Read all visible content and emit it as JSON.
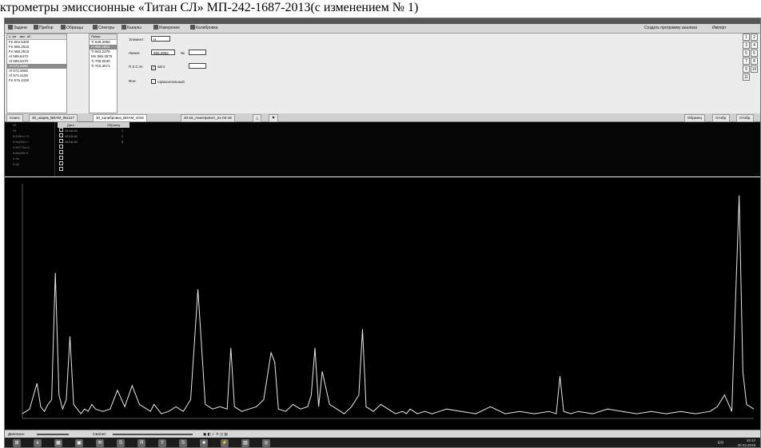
{
  "caption": "ктрометры эмиссионные «Титан СЛ»     МП-242-1687-2013(с изменением № 1)",
  "toolbar": {
    "items": [
      "Задачи",
      "Прибор",
      "Образцы",
      "Спектры",
      "Каналы",
      "Измерение",
      "Калибровка"
    ],
    "right_link": "Создать программу анализа",
    "right_menu": "Импорт"
  },
  "left_list": {
    "headers": [
      "λ, нм",
      "мкл",
      "α0"
    ],
    "items": [
      "Fe 504.5400",
      "Fe 566.2515",
      "Fe 568.2515",
      "Al 569.6470",
      "Al 569.6470",
      "Al 572.2650",
      "Al 572.2650",
      "Al 574.4150",
      "Fe 576.4150"
    ],
    "selected_index": 5
  },
  "line_list": {
    "header": "Линия",
    "items": [
      "Ti 649.2968",
      "H 656.2852",
      "Ti 662.2375",
      "Mn 686.3575",
      "Ti 708.2040",
      "Ti 715.3671"
    ],
    "selected_index": 1
  },
  "form": {
    "element_label": "Элемент:",
    "element_value": "H",
    "line_label": "Линия:",
    "line_value": "656.2852",
    "nr_label": "№",
    "ps_label": "П.З.С.%:",
    "ps_check": "авто",
    "phon_label": "Фон:",
    "phon_check": "горизонтальный"
  },
  "num_grid": [
    "1",
    "2",
    "3",
    "4",
    "5",
    "6",
    "7",
    "8",
    "9",
    "10",
    "11"
  ],
  "tabs": [
    "Сеанс",
    "30_шарик_ВИАМ_051117",
    "30_калибровка_ВИАМ_1018",
    "40-18_Анкетфлинт_21-02-18"
  ],
  "tabs_right": [
    "Образец",
    "Отобр.",
    "Отобр."
  ],
  "dark_left": [
    "Hf",
    "Hf",
    "6.8.8Fe=+2",
    "5.5d1Rb+=",
    "0.8d773н+2",
    "8.8d1Rb+1",
    "9.9d",
    "5.5d"
  ],
  "dark_table": {
    "headers": [
      "Дата",
      "Образец"
    ],
    "rows": [
      "15:16:16",
      "15:16:16",
      "15:16:16",
      "",
      "",
      "",
      "",
      ""
    ],
    "counts": [
      "1",
      "2",
      "3"
    ]
  },
  "statusbar": {
    "left": "Диапазон:",
    "mid": "Сжатие:"
  },
  "taskbar": {
    "icons": [
      "windows-icon",
      "edge-icon",
      "explorer-icon",
      "store-icon",
      "mail-icon",
      "skype-icon",
      "yandex-icon",
      "yandex-browser-icon",
      "skype2-icon",
      "terminal-icon",
      "spectrum-icon",
      "paint-icon",
      "other-icon"
    ],
    "lang": "EN",
    "time": "15:14",
    "date": "20.03.2019"
  },
  "chart_data": {
    "type": "line",
    "title": "",
    "xlabel": "",
    "ylabel": "",
    "x_range": [
      0,
      1
    ],
    "ylim": [
      0,
      1
    ],
    "grid": false,
    "series": [
      {
        "x": [
          0.0,
          0.01,
          0.02,
          0.025,
          0.03,
          0.035,
          0.04,
          0.045,
          0.05,
          0.055,
          0.06,
          0.065,
          0.07,
          0.08,
          0.085,
          0.09,
          0.095,
          0.1,
          0.11,
          0.12,
          0.13,
          0.14,
          0.15,
          0.16,
          0.17,
          0.175,
          0.18,
          0.19,
          0.2,
          0.21,
          0.22,
          0.23,
          0.24,
          0.25,
          0.26,
          0.27,
          0.28,
          0.285,
          0.29,
          0.3,
          0.31,
          0.32,
          0.33,
          0.34,
          0.345,
          0.35,
          0.36,
          0.37,
          0.38,
          0.39,
          0.395,
          0.4,
          0.405,
          0.41,
          0.42,
          0.43,
          0.44,
          0.45,
          0.46,
          0.465,
          0.47,
          0.48,
          0.49,
          0.5,
          0.51,
          0.52,
          0.525,
          0.53,
          0.54,
          0.55,
          0.56,
          0.57,
          0.58,
          0.6,
          0.62,
          0.64,
          0.66,
          0.68,
          0.7,
          0.72,
          0.73,
          0.735,
          0.74,
          0.75,
          0.76,
          0.78,
          0.8,
          0.82,
          0.84,
          0.86,
          0.88,
          0.9,
          0.92,
          0.94,
          0.95,
          0.96,
          0.97,
          0.975,
          0.98,
          0.985,
          0.99,
          1.0
        ],
        "y": [
          0.02,
          0.04,
          0.15,
          0.05,
          0.03,
          0.06,
          0.08,
          0.62,
          0.1,
          0.04,
          0.08,
          0.35,
          0.06,
          0.02,
          0.04,
          0.03,
          0.06,
          0.04,
          0.03,
          0.04,
          0.12,
          0.05,
          0.14,
          0.06,
          0.04,
          0.03,
          0.06,
          0.02,
          0.03,
          0.05,
          0.03,
          0.08,
          0.55,
          0.06,
          0.04,
          0.05,
          0.04,
          0.3,
          0.05,
          0.03,
          0.04,
          0.05,
          0.08,
          0.28,
          0.24,
          0.04,
          0.03,
          0.06,
          0.04,
          0.05,
          0.1,
          0.3,
          0.05,
          0.2,
          0.06,
          0.04,
          0.02,
          0.05,
          0.1,
          0.38,
          0.05,
          0.03,
          0.06,
          0.04,
          0.02,
          0.03,
          0.02,
          0.04,
          0.02,
          0.03,
          0.02,
          0.03,
          0.04,
          0.03,
          0.02,
          0.05,
          0.02,
          0.03,
          0.02,
          0.03,
          0.02,
          0.18,
          0.03,
          0.02,
          0.03,
          0.02,
          0.04,
          0.03,
          0.02,
          0.03,
          0.02,
          0.03,
          0.02,
          0.03,
          0.05,
          0.1,
          0.03,
          0.5,
          0.95,
          0.2,
          0.06,
          0.04
        ]
      }
    ]
  }
}
